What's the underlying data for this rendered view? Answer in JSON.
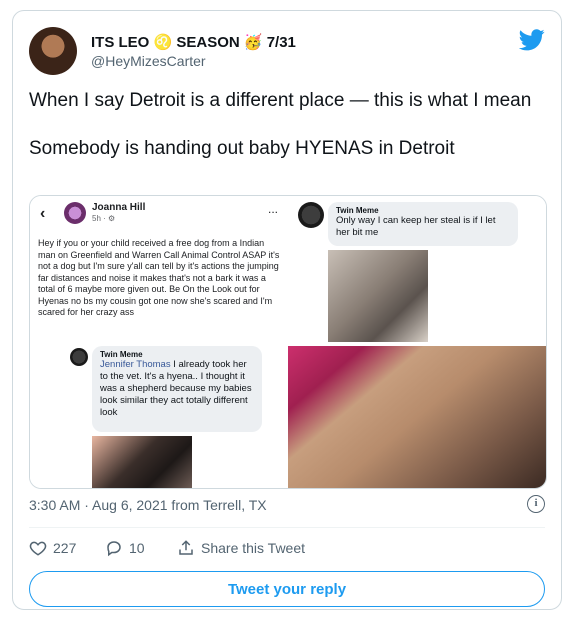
{
  "user": {
    "display_name": "ITS LEO ♌ SEASON 🥳 7/31",
    "handle": "@HeyMizesCarter"
  },
  "tweet": {
    "line1": "When I say Detroit is a different place — this is what I mean",
    "line2": "Somebody is handing out baby HYENAS in Detroit"
  },
  "media": {
    "fb_post": {
      "back": "‹",
      "author": "Joanna Hill",
      "time": "5h · ⚙",
      "more": "...",
      "body": "Hey if you or your child received a free dog from a Indian man on Greenfield and Warren Call Animal Control ASAP it's not a dog but I'm sure y'all can tell by it's actions the jumping far distances and noise it makes that's not a bark it was a total of 6 maybe more given out. Be On the Look out for Hyenas no bs my cousin got one now she's scared and I'm scared for her crazy ass"
    },
    "comment1": {
      "author": "Twin Meme",
      "text": "Only way I can keep her steal is if I let her bit me"
    },
    "comment2": {
      "author": "Twin Meme",
      "mention": "Jennifer Thomas",
      "text": " I already took her to the vet. It's a hyena.. I thought it was a shepherd because my babies look similar they act totally different look"
    }
  },
  "meta": {
    "timestamp": "3:30 AM · Aug 6, 2021 from Terrell, TX",
    "info_icon": "i"
  },
  "actions": {
    "likes": "227",
    "replies": "10",
    "share": "Share this Tweet"
  },
  "reply_button": "Tweet your reply",
  "colors": {
    "accent": "#1d9bf0",
    "secondary_text": "#536471"
  }
}
